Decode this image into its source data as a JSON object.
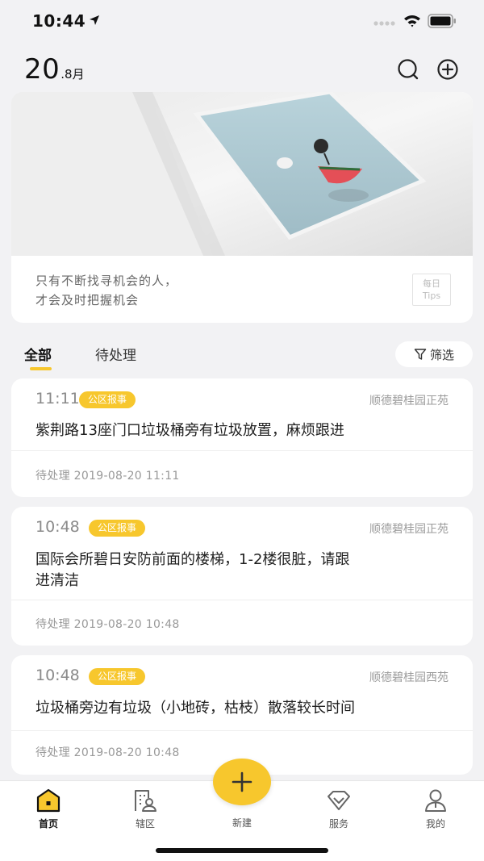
{
  "status_bar": {
    "time": "10:44"
  },
  "header": {
    "day": "20",
    "month": ".8月"
  },
  "tips": {
    "line1": "只有不断找寻机会的人，",
    "line2": "才会及时把握机会",
    "badge_line1": "每日",
    "badge_line2": "Tips"
  },
  "tabs": {
    "all": "全部",
    "pending": "待处理"
  },
  "filter": {
    "label": "筛选"
  },
  "reports": [
    {
      "time": "11:11",
      "tag": "公区报事",
      "location": "顺德碧桂园正苑",
      "title": "紫荆路13座门口垃圾桶旁有垃圾放置，麻烦跟进",
      "status": "待处理 2019-08-20 11:11"
    },
    {
      "time": "10:48",
      "tag": "公区报事",
      "location": "顺德碧桂园正苑",
      "title_line1": "国际会所碧日安防前面的楼梯，1-2楼很脏，请跟",
      "title_line2": "进清洁",
      "status": "待处理 2019-08-20 10:48"
    },
    {
      "time": "10:48",
      "tag": "公区报事",
      "location": "顺德碧桂园西苑",
      "title": "垃圾桶旁边有垃圾（小地砖，枯枝）散落较长时间",
      "status": "待处理 2019-08-20 10:48"
    }
  ],
  "nav": {
    "home": "首页",
    "district": "辖区",
    "new": "新建",
    "service": "服务",
    "mine": "我的"
  },
  "colors": {
    "accent": "#f7c72d",
    "background": "#f2f2f4"
  }
}
